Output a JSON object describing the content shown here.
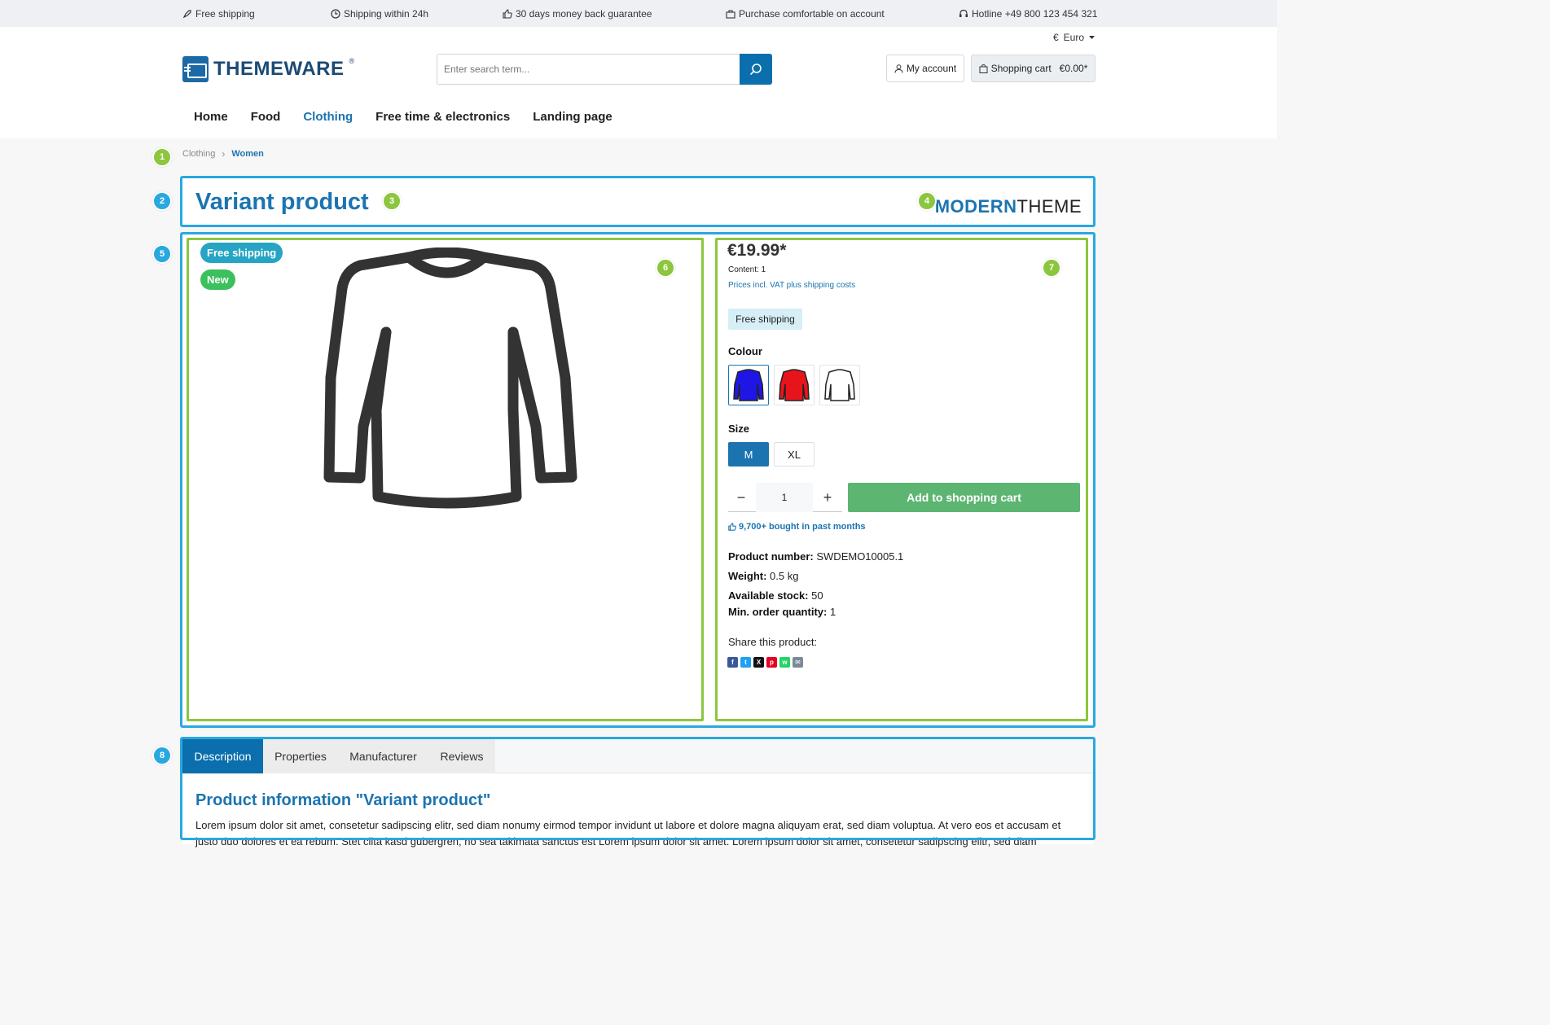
{
  "topbar": {
    "usps": [
      {
        "icon": "rocket-icon",
        "label": "Free shipping"
      },
      {
        "icon": "clock-icon",
        "label": "Shipping within 24h"
      },
      {
        "icon": "thumbs-up-icon",
        "label": "30 days money back guarantee"
      },
      {
        "icon": "briefcase-icon",
        "label": "Purchase comfortable on account"
      },
      {
        "icon": "headset-icon",
        "label": "Hotline +49 800 123 454 321"
      }
    ]
  },
  "header": {
    "currency_symbol": "€",
    "currency": "Euro",
    "logo_text": "THEMEWARE",
    "logo_reg": "®",
    "search_placeholder": "Enter search term...",
    "account_label": "My account",
    "cart_label": "Shopping cart",
    "cart_total": "€0.00*"
  },
  "nav": {
    "items": [
      {
        "label": "Home",
        "active": false
      },
      {
        "label": "Food",
        "active": false
      },
      {
        "label": "Clothing",
        "active": true
      },
      {
        "label": "Free time & electronics",
        "active": false
      },
      {
        "label": "Landing page",
        "active": false
      }
    ]
  },
  "breadcrumb": [
    "Clothing",
    "Women"
  ],
  "markers": [
    "1",
    "2",
    "3",
    "4",
    "5",
    "6",
    "7",
    "8"
  ],
  "product": {
    "title": "Variant product",
    "brand_bold": "MODERN",
    "brand_rest": "THEME",
    "badges": [
      "Free shipping",
      "New"
    ],
    "price": "€19.99*",
    "content": "Content: 1",
    "vat_note": "Prices incl. VAT plus shipping costs",
    "shipping_pill": "Free shipping",
    "colour_label": "Colour",
    "colours": [
      "#1f16e6",
      "#e8141c",
      "#ffffff"
    ],
    "size_label": "Size",
    "sizes": [
      {
        "label": "M",
        "selected": true
      },
      {
        "label": "XL",
        "selected": false
      }
    ],
    "quantity": "1",
    "qty_minus": "−",
    "qty_plus": "+",
    "add_to_cart": "Add to shopping cart",
    "bought": "9,700+ bought in past months",
    "specs": [
      {
        "key": "Product number:",
        "value": "SWDEMO10005.1"
      },
      {
        "key": "Weight:",
        "value": "0.5 kg"
      },
      {
        "key": "Available stock:",
        "value": "50"
      },
      {
        "key": "Min. order quantity:",
        "value": "1"
      }
    ],
    "share_label": "Share this product:",
    "share_icons": [
      {
        "name": "facebook-icon",
        "glyph": "f",
        "color": "#3b5998"
      },
      {
        "name": "twitter-icon",
        "glyph": "t",
        "color": "#1da1f2"
      },
      {
        "name": "x-icon",
        "glyph": "X",
        "color": "#111111"
      },
      {
        "name": "pinterest-icon",
        "glyph": "p",
        "color": "#e60023"
      },
      {
        "name": "whatsapp-icon",
        "glyph": "w",
        "color": "#25d366"
      },
      {
        "name": "mail-icon",
        "glyph": "✉",
        "color": "#7a8a99"
      }
    ]
  },
  "tabs": {
    "items": [
      "Description",
      "Properties",
      "Manufacturer",
      "Reviews"
    ],
    "heading": "Product information \"Variant product\"",
    "text": "Lorem ipsum dolor sit amet, consetetur sadipscing elitr, sed diam nonumy eirmod tempor invidunt ut labore et dolore magna aliquyam erat, sed diam voluptua. At vero eos et accusam et justo duo dolores et ea rebum. Stet clita kasd gubergren, no sea takimata sanctus est Lorem ipsum dolor sit amet. Lorem ipsum dolor sit amet, consetetur sadipscing elitr, sed diam"
  },
  "colors": {
    "accent": "#1b74b0",
    "primary_button": "#0b6fad",
    "cart_button": "#5db572",
    "annotation_blue": "#29a8e0",
    "annotation_green": "#8cc63e"
  }
}
